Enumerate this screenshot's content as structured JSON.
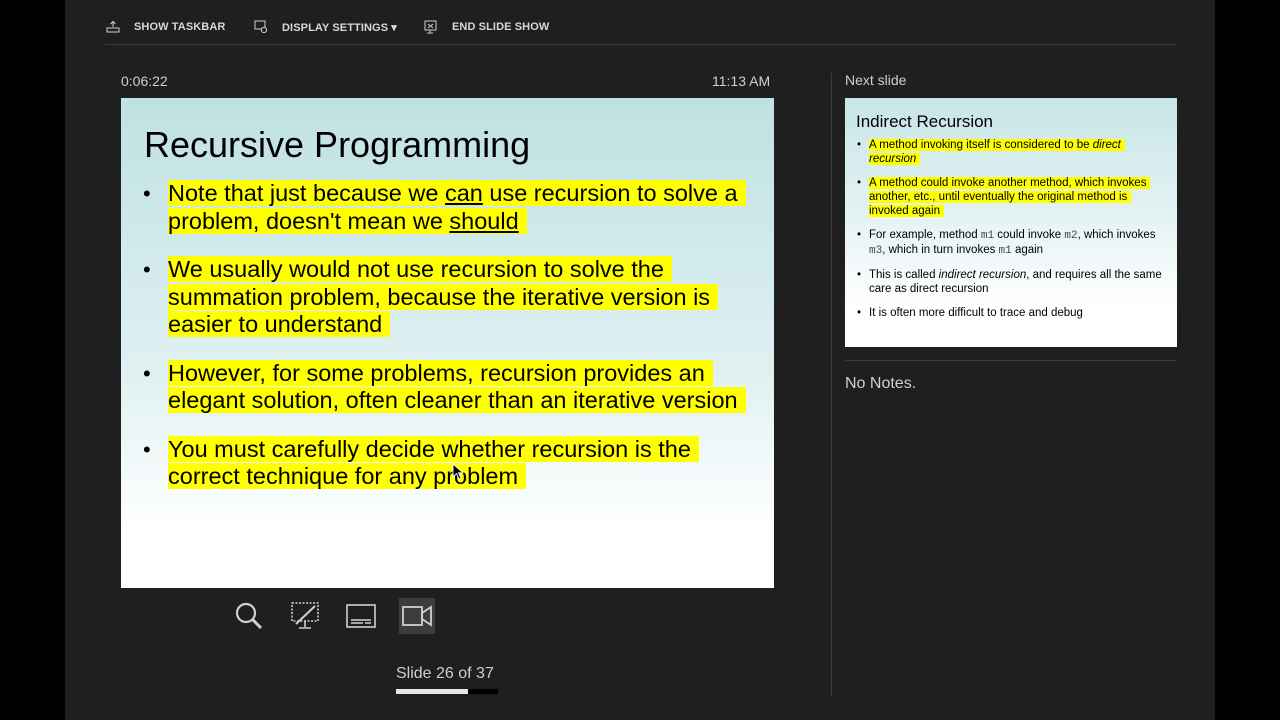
{
  "toolbar": {
    "show_taskbar": "SHOW TASKBAR",
    "display_settings": "DISPLAY SETTINGS ▾",
    "end_slide_show": "END SLIDE SHOW"
  },
  "timer": "0:06:22",
  "clock": "11:13 AM",
  "current_slide": {
    "title": "Recursive Programming",
    "b1_pre": "Note that just because we ",
    "b1_u1": "can",
    "b1_mid": " use recursion to solve a problem, doesn't mean we ",
    "b1_u2": "should",
    "b2": "We usually would not use recursion to solve the summation problem, because the iterative version is easier to understand",
    "b3": "However, for some problems, recursion provides an elegant solution, often cleaner than an iterative version",
    "b4": "You must carefully decide whether recursion is the correct technique for any problem"
  },
  "tools": {
    "zoom": "magnifier-icon",
    "pen": "pen-screen-icon",
    "subtitles": "subtitles-icon",
    "camera": "camera-icon"
  },
  "slide_counter": "Slide 26 of 37",
  "progress_fraction": 0.7027,
  "next_slide_label": "Next slide",
  "next_slide": {
    "title": "Indirect Recursion",
    "b1_pre": "A method invoking itself is considered to be ",
    "b1_it": "direct recursion",
    "b2": "A method could invoke another method, which invokes another, etc., until eventually the original method is invoked again",
    "b3_pre": "For example, method ",
    "b3_m1": "m1",
    "b3_mid1": " could invoke ",
    "b3_m2": "m2",
    "b3_mid2": ", which invokes ",
    "b3_m3": "m3",
    "b3_mid3": ", which in turn invokes ",
    "b3_m1b": "m1",
    "b3_post": " again",
    "b4_pre": "This is called ",
    "b4_it": "indirect recursion",
    "b4_post": ", and requires all the same care as direct recursion",
    "b5": "It is often more difficult to trace and debug"
  },
  "notes": "No Notes."
}
